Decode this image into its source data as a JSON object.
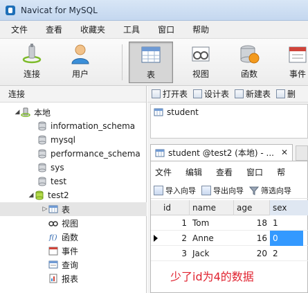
{
  "window": {
    "title": "Navicat for MySQL"
  },
  "menubar": [
    "文件",
    "查看",
    "收藏夹",
    "工具",
    "窗口",
    "帮助"
  ],
  "toolbar": {
    "buttons": [
      {
        "label": "连接",
        "icon": "connection-icon"
      },
      {
        "label": "用户",
        "icon": "user-icon"
      },
      {
        "label": "表",
        "icon": "table-icon",
        "active": true
      },
      {
        "label": "视图",
        "icon": "view-icon"
      },
      {
        "label": "函数",
        "icon": "function-icon"
      },
      {
        "label": "事件",
        "icon": "event-icon"
      }
    ]
  },
  "sidebar": {
    "header": "连接",
    "tree": [
      {
        "label": "本地",
        "icon": "server-icon"
      },
      {
        "label": "information_schema",
        "icon": "database-icon"
      },
      {
        "label": "mysql",
        "icon": "database-icon"
      },
      {
        "label": "performance_schema",
        "icon": "database-icon"
      },
      {
        "label": "sys",
        "icon": "database-icon"
      },
      {
        "label": "test",
        "icon": "database-icon"
      },
      {
        "label": "test2",
        "icon": "database-open-icon"
      },
      {
        "label": "表",
        "icon": "table-icon"
      },
      {
        "label": "视图",
        "icon": "view-icon"
      },
      {
        "label": "函数",
        "icon": "function-icon"
      },
      {
        "label": "事件",
        "icon": "event-icon"
      },
      {
        "label": "查询",
        "icon": "query-icon"
      },
      {
        "label": "报表",
        "icon": "report-icon"
      }
    ]
  },
  "object_toolbar": [
    "打开表",
    "设计表",
    "新建表",
    "删"
  ],
  "object_list": [
    "student"
  ],
  "tab": {
    "label": "student @test2 (本地) - ...",
    "close": "✕"
  },
  "editor": {
    "menu": [
      "文件",
      "编辑",
      "查看",
      "窗口",
      "帮"
    ],
    "tools": [
      "导入向导",
      "导出向导",
      "筛选向导"
    ],
    "columns": [
      "id",
      "name",
      "age",
      "sex"
    ],
    "rows": [
      [
        "1",
        "Tom",
        "18",
        "1"
      ],
      [
        "2",
        "Anne",
        "16",
        "0"
      ],
      [
        "3",
        "Jack",
        "20",
        "2"
      ]
    ],
    "selected_row": 1
  },
  "annotation": "少了id为4的数据",
  "colors": {
    "selection": "#3399ff",
    "annotation": "#e0222f"
  }
}
